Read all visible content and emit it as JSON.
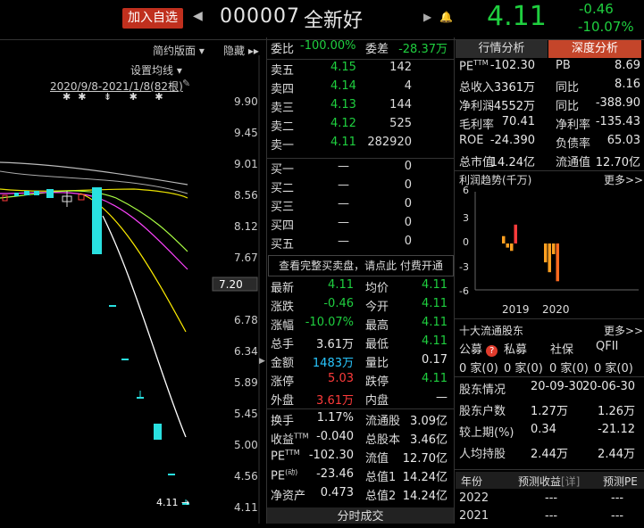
{
  "header": {
    "add_watchlist": "加入自选",
    "code": "000007",
    "name": "全新好",
    "price": "4.11",
    "change": "-0.46",
    "change_pct": "-10.07%"
  },
  "chart": {
    "mode_button": "简约版面",
    "hide_button": "隐藏",
    "settings": "设置均线",
    "range_label": "2020/9/8-2021/1/8(82根)",
    "price_axis": [
      "9.90",
      "9.45",
      "9.01",
      "8.56",
      "8.12",
      "7.67",
      "7.20",
      "6.78",
      "6.34",
      "5.89",
      "5.45",
      "5.00",
      "4.56",
      "4.11"
    ],
    "low_marker": "4.11"
  },
  "orderbook": {
    "wb_label": "委比",
    "wb_value": "-100.00%",
    "wc_label": "委差",
    "wc_value": "-28.37万",
    "asks": [
      {
        "label": "卖五",
        "price": "4.15",
        "vol": "142"
      },
      {
        "label": "卖四",
        "price": "4.14",
        "vol": "4"
      },
      {
        "label": "卖三",
        "price": "4.13",
        "vol": "144"
      },
      {
        "label": "卖二",
        "price": "4.12",
        "vol": "525"
      },
      {
        "label": "卖一",
        "price": "4.11",
        "vol": "282920"
      }
    ],
    "bids": [
      {
        "label": "买一",
        "price": "—",
        "vol": "0"
      },
      {
        "label": "买二",
        "price": "—",
        "vol": "0"
      },
      {
        "label": "买三",
        "price": "—",
        "vol": "0"
      },
      {
        "label": "买四",
        "price": "—",
        "vol": "0"
      },
      {
        "label": "买五",
        "price": "—",
        "vol": "0"
      }
    ],
    "banner_text": "查看完整买卖盘，请点此",
    "banner_link": "付费开通"
  },
  "stats": [
    {
      "l1": "最新",
      "v1": "4.11",
      "l2": "均价",
      "v2": "4.11"
    },
    {
      "l1": "涨跌",
      "v1": "-0.46",
      "l2": "今开",
      "v2": "4.11"
    },
    {
      "l1": "涨幅",
      "v1": "-10.07%",
      "l2": "最高",
      "v2": "4.11"
    },
    {
      "l1": "总手",
      "v1": "3.61万",
      "l2": "最低",
      "v2": "4.11"
    },
    {
      "l1": "金额",
      "v1": "1483万",
      "l2": "量比",
      "v2": "0.17"
    },
    {
      "l1": "涨停",
      "v1": "5.03",
      "l2": "跌停",
      "v2": "4.11"
    },
    {
      "l1": "外盘",
      "v1": "3.61万",
      "l2": "内盘",
      "v2": "—"
    }
  ],
  "stats2": [
    {
      "l1": "换手",
      "v1": "1.17%",
      "l2": "流通股",
      "v2": "3.09亿"
    },
    {
      "l1": "收益",
      "sup1": "TTM",
      "v1": "-0.040",
      "l2": "总股本",
      "v2": "3.46亿"
    },
    {
      "l1": "PE",
      "sup1": "TTM",
      "v1": "-102.30",
      "l2": "流值",
      "v2": "12.70亿"
    },
    {
      "l1": "PE",
      "sup1": "(动)",
      "v1": "-23.46",
      "l2": "总值1",
      "v2": "14.24亿"
    },
    {
      "l1": "净资产",
      "v1": "0.473",
      "l2": "总值2",
      "v2": "14.24亿"
    }
  ],
  "bottom_tab": "分时成交",
  "right": {
    "tab_industry": "行情分析",
    "tab_depth": "深度分析",
    "fund": [
      {
        "l1": "PE",
        "sup": "TTM",
        "v1": "-102.30",
        "l2": "PB",
        "v2": "8.69"
      },
      {
        "l1": "总收入",
        "v1": "3361万",
        "l2": "同比",
        "v2": "8.16"
      },
      {
        "l1": "净利润",
        "v1": "-4552万",
        "l2": "同比",
        "v2": "-388.90"
      },
      {
        "l1": "毛利率",
        "v1": "70.41",
        "l2": "净利率",
        "v2": "-135.43"
      },
      {
        "l1": "ROE",
        "v1": "-24.390",
        "l2": "负债率",
        "v2": "65.03"
      },
      {
        "l1": "总市值",
        "v1": "14.24亿",
        "l2": "流通值",
        "v2": "12.70亿"
      }
    ],
    "profit_title": "利润趋势(千万)",
    "more": "更多>>",
    "profit_chart": {
      "type": "bar",
      "y_ticks": [
        "6",
        "3",
        "0",
        "-3",
        "-6"
      ],
      "x_labels": [
        "2019",
        "2020"
      ],
      "values_2019": [
        0.9,
        -0.5,
        -0.9,
        2.3
      ],
      "values_2020": [
        -2.3,
        -3.5,
        -1.3,
        -4.6
      ]
    },
    "holders_title": "十大流通股东",
    "holder_types": [
      "公募",
      "私募",
      "社保",
      "QFII"
    ],
    "holder_counts": [
      "0 家(0)",
      "0 家(0)",
      "0 家(0)",
      "0 家(0)"
    ],
    "share_rows": [
      {
        "l": "股东情况",
        "a": "20-09-30",
        "b": "20-06-30"
      },
      {
        "l": "股东户数",
        "a": "1.27万",
        "b": "1.26万"
      },
      {
        "l": "较上期(%)",
        "a": "0.34",
        "b": "-21.12"
      },
      {
        "l": "人均持股",
        "a": "2.44万",
        "b": "2.44万"
      }
    ],
    "forecast_head": [
      "年份",
      "预测收益",
      "[详]",
      "预测PE"
    ],
    "forecast_rows": [
      {
        "y": "2022",
        "e": "---",
        "pe": "---"
      },
      {
        "y": "2021",
        "e": "---",
        "pe": "---"
      }
    ]
  },
  "colors": {
    "up": "#ff3b3b",
    "down": "#1fcf3f",
    "accent": "#c0301e"
  }
}
